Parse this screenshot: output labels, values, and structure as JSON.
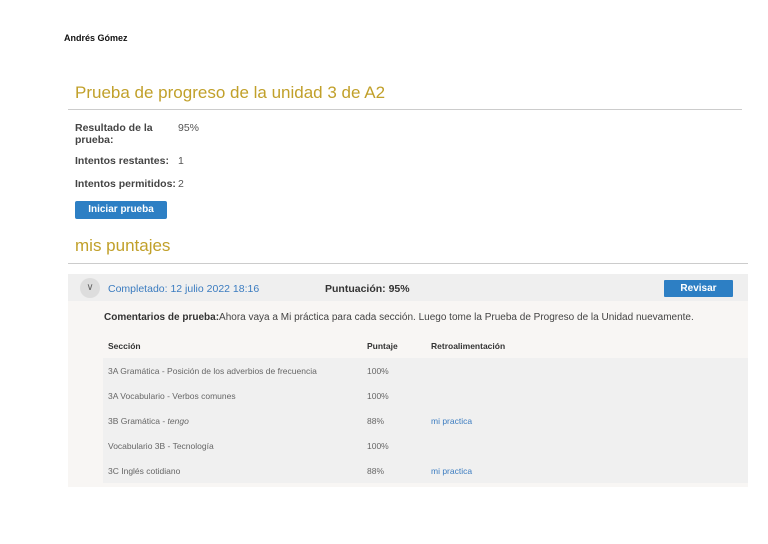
{
  "user_name": "Andrés Gómez",
  "title": "Prueba de progreso de la unidad 3 de A2",
  "summary": {
    "result_label": "Resultado de la prueba:",
    "result_value": "95%",
    "remaining_label": "Intentos restantes:",
    "remaining_value": "1",
    "allowed_label": "Intentos permitidos:",
    "allowed_value": "2"
  },
  "start_button": "Iniciar prueba",
  "scores_title": "mis puntajes",
  "attempt": {
    "completed": "Completado: 12 julio 2022 18:16",
    "score": "Puntuación: 95%",
    "review_button": "Revisar",
    "comment_label": "Comentarios de prueba:",
    "comment_text": "Ahora vaya a Mi práctica para cada sección. Luego tome la Prueba de Progreso de la Unidad nuevamente.",
    "columns": [
      "Sección",
      "Puntaje",
      "Retroalimentación"
    ],
    "rows": [
      {
        "section": "3A Gramática - Posición de los adverbios de frecuencia",
        "score": "100%",
        "feedback": ""
      },
      {
        "section": "3A Vocabulario - Verbos comunes",
        "score": "100%",
        "feedback": ""
      },
      {
        "section_prefix": "3B Gramática - ",
        "section_em": "tengo",
        "score": "88%",
        "feedback": "mi practica"
      },
      {
        "section": "Vocabulario 3B - Tecnología",
        "score": "100%",
        "feedback": ""
      },
      {
        "section": "3C Inglés cotidiano",
        "score": "88%",
        "feedback": "mi practica"
      }
    ]
  }
}
